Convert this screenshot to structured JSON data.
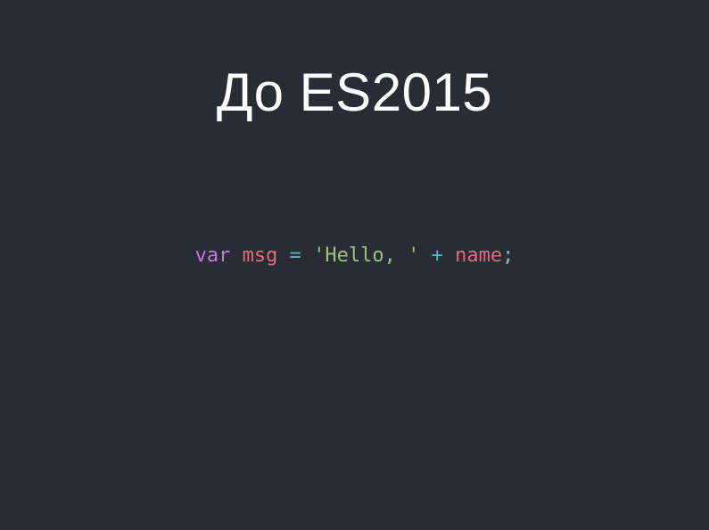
{
  "slide": {
    "title": "До ES2015",
    "code": {
      "tokens": [
        {
          "text": "var",
          "role": "keyword",
          "color": "#c678dd"
        },
        {
          "text": " ",
          "role": "space",
          "color": "#abb2bf"
        },
        {
          "text": "msg",
          "role": "variable",
          "color": "#e06c75"
        },
        {
          "text": " ",
          "role": "space",
          "color": "#abb2bf"
        },
        {
          "text": "=",
          "role": "operator",
          "color": "#56b6c2"
        },
        {
          "text": " ",
          "role": "space",
          "color": "#abb2bf"
        },
        {
          "text": "'Hello, '",
          "role": "string",
          "color": "#98c379"
        },
        {
          "text": " ",
          "role": "space",
          "color": "#abb2bf"
        },
        {
          "text": "+",
          "role": "operator",
          "color": "#56b6c2"
        },
        {
          "text": " ",
          "role": "space",
          "color": "#abb2bf"
        },
        {
          "text": "name",
          "role": "variable",
          "color": "#e06c75"
        },
        {
          "text": ";",
          "role": "punctuation",
          "color": "#abb2bf"
        }
      ]
    }
  },
  "colors": {
    "background": "#282c34",
    "title": "#ffffff"
  }
}
